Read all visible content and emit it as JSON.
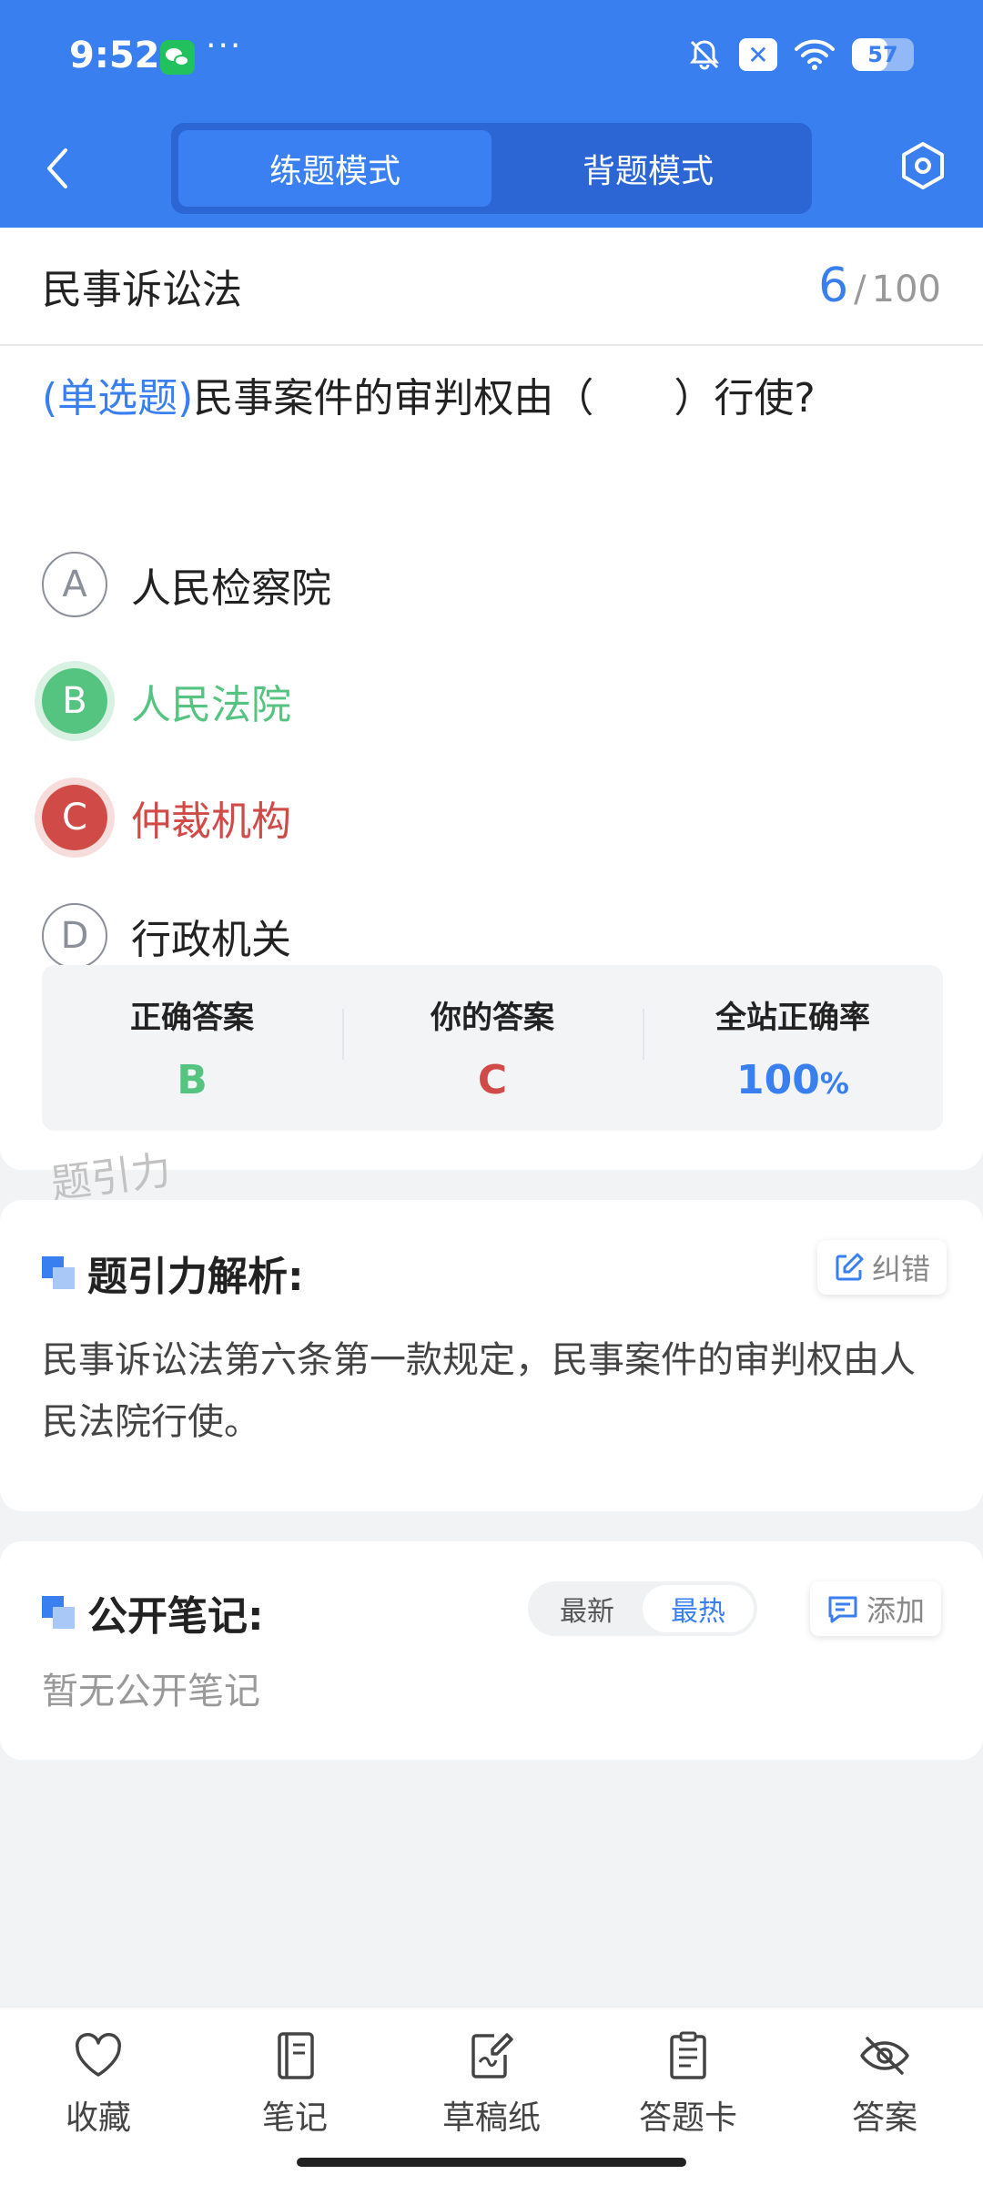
{
  "status_bar": {
    "time": "9:52",
    "more": "···",
    "battery": 57,
    "icons": [
      "wechat-icon",
      "bell-muted-icon",
      "x-box-icon",
      "wifi-icon",
      "battery-icon"
    ]
  },
  "header": {
    "back_icon": "chevron-left-icon",
    "modes": [
      {
        "label": "练题模式",
        "active": true
      },
      {
        "label": "背题模式",
        "active": false
      }
    ],
    "settings_icon": "hexagon-settings-icon"
  },
  "question": {
    "subject": "民事诉讼法",
    "current": "6",
    "separator": "/",
    "total": "100",
    "type": "(单选题)",
    "text": "民事案件的审判权由（　　）行使?",
    "options": [
      {
        "letter": "A",
        "text": "人民检察院",
        "state": "normal"
      },
      {
        "letter": "B",
        "text": "人民法院",
        "state": "correct"
      },
      {
        "letter": "C",
        "text": "仲裁机构",
        "state": "wrong"
      },
      {
        "letter": "D",
        "text": "行政机关",
        "state": "normal"
      }
    ]
  },
  "answers": {
    "correct_label": "正确答案",
    "correct_value": "B",
    "yours_label": "你的答案",
    "yours_value": "C",
    "rate_label": "全站正确率",
    "rate_value": "100",
    "rate_unit": "%"
  },
  "watermark": "题引力",
  "analysis": {
    "title": "题引力解析:",
    "report_label": "纠错",
    "text": "民事诉讼法第六条第一款规定，民事案件的审判权由人民法院行使。"
  },
  "notes": {
    "title": "公开笔记:",
    "sort_options": [
      {
        "label": "最新",
        "active": false
      },
      {
        "label": "最热",
        "active": true
      }
    ],
    "add_label": "添加",
    "empty_text": "暂无公开笔记"
  },
  "bottom_tabs": [
    {
      "label": "收藏",
      "icon": "heart-icon"
    },
    {
      "label": "笔记",
      "icon": "notebook-icon"
    },
    {
      "label": "草稿纸",
      "icon": "draft-paper-icon"
    },
    {
      "label": "答题卡",
      "icon": "answer-sheet-icon"
    },
    {
      "label": "答案",
      "icon": "eye-off-icon"
    }
  ],
  "colors": {
    "brand": "#3a7ff0",
    "correct": "#55c481",
    "wrong": "#d04b48"
  }
}
